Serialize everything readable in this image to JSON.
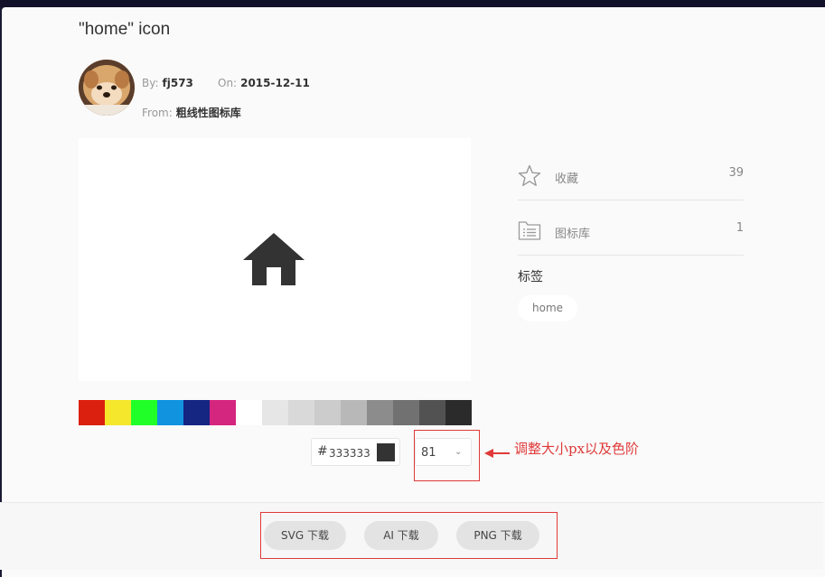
{
  "title": "\"home\" icon",
  "author": {
    "by_label": "By:",
    "by_value": "fj573",
    "on_label": "On:",
    "on_value": "2015-12-11",
    "from_label": "From:",
    "from_value": "粗线性图标库"
  },
  "preview": {
    "icon": "home-icon",
    "color": "#333333"
  },
  "swatches": [
    "#dc2010",
    "#f5e82c",
    "#21ff29",
    "#1193e0",
    "#142582",
    "#d4257f",
    "#ffffff",
    "#e6e6e6",
    "#d9d9d9",
    "#cccccc",
    "#b8b8b8",
    "#8c8c8c",
    "#717171",
    "#525252",
    "#2b2b2b"
  ],
  "color_picker": {
    "hash": "#",
    "value": "333333",
    "swatch": "#333333"
  },
  "size_select": {
    "value": "81",
    "chevron": "⌄"
  },
  "annotation": {
    "text": "调整大小px以及色阶",
    "color": "#e03a3a"
  },
  "sidebar": {
    "favorites": {
      "icon": "star-icon",
      "label": "收藏",
      "count": "39"
    },
    "library": {
      "icon": "folder-list-icon",
      "label": "图标库",
      "count": "1"
    },
    "tags_heading": "标签",
    "tags": [
      "home"
    ]
  },
  "downloads": {
    "svg": "SVG 下载",
    "ai": "AI 下载",
    "png": "PNG 下载"
  }
}
